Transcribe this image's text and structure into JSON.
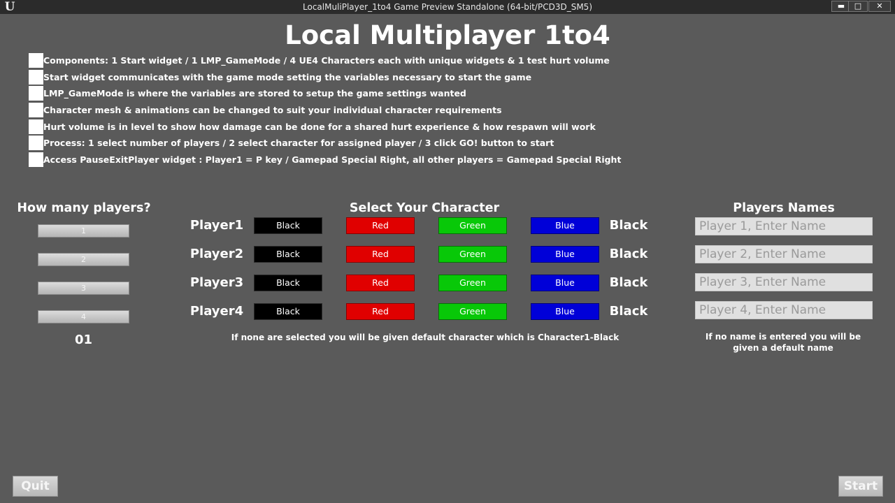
{
  "window": {
    "title": "LocalMuliPlayer_1to4 Game Preview Standalone (64-bit/PCD3D_SM5)",
    "logo": "U",
    "min_glyph": "▬",
    "max_glyph": "□",
    "close_glyph": "✕"
  },
  "title": "Local Multiplayer 1to4",
  "info": [
    "Components: 1 Start widget / 1 LMP_GameMode / 4 UE4 Characters each with unique widgets & 1 test hurt volume",
    "Start widget communicates with the game mode setting the variables necessary to start the game",
    "LMP_GameMode is where the variables are stored to setup the game settings wanted",
    "Character mesh & animations can be changed to suit your individual character requirements",
    "Hurt volume is in level to show how damage can be done for a shared hurt experience & how respawn will work",
    "Process: 1 select number of players / 2 select character for assigned player / 3 click GO! button to start",
    "Access PauseExitPlayer widget : Player1 = P key / Gamepad Special Right, all other players = Gamepad Special Right"
  ],
  "players_count": {
    "heading": "How many players?",
    "options": [
      "1",
      "2",
      "3",
      "4"
    ],
    "value": "01"
  },
  "character_select": {
    "heading": "Select Your Character",
    "colors": [
      "Black",
      "Red",
      "Green",
      "Blue"
    ],
    "note": "If none are selected you will be given default character which is Character1-Black"
  },
  "players": [
    {
      "label": "Player1",
      "selected": "Black",
      "name_placeholder": "Player 1, Enter Name"
    },
    {
      "label": "Player2",
      "selected": "Black",
      "name_placeholder": "Player 2, Enter Name"
    },
    {
      "label": "Player3",
      "selected": "Black",
      "name_placeholder": "Player 3, Enter Name"
    },
    {
      "label": "Player4",
      "selected": "Black",
      "name_placeholder": "Player 4, Enter Name"
    }
  ],
  "names": {
    "heading": "Players Names",
    "note": "If no name is entered you will be given a default name"
  },
  "buttons": {
    "quit": "Quit",
    "start": "Start"
  },
  "colors": {
    "background": "#5a5a5a",
    "black": "#000000",
    "red": "#e00000",
    "green": "#08c808",
    "blue": "#0000d8"
  }
}
